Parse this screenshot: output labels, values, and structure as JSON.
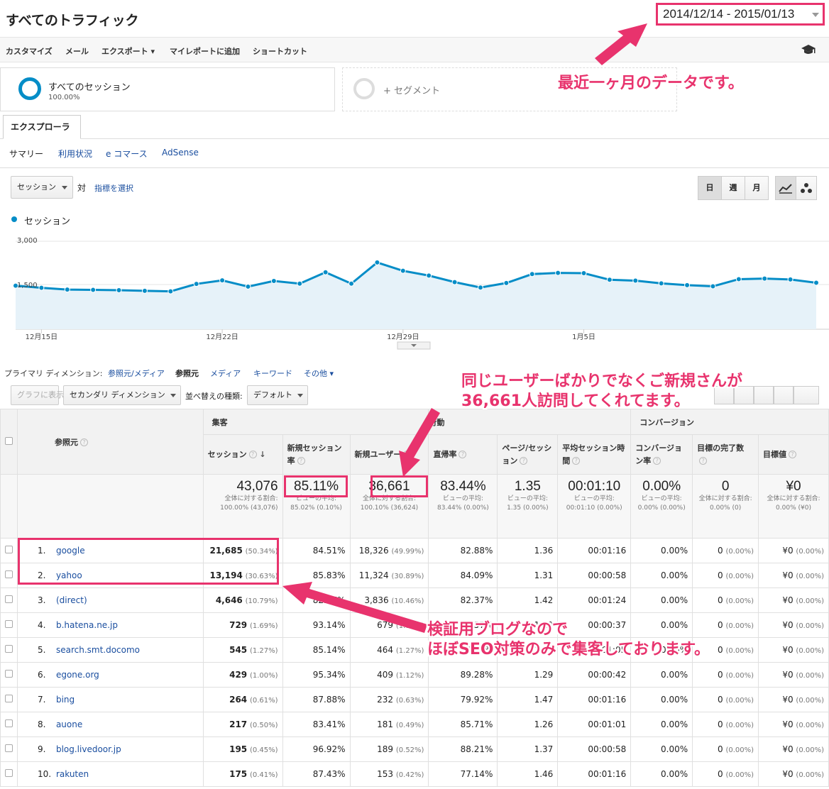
{
  "header": {
    "title": "すべてのトラフィック",
    "date_range": "2014/12/14 - 2015/01/13"
  },
  "toolbar": [
    "カスタマイズ",
    "メール",
    "エクスポート ▾",
    "マイレポートに追加",
    "ショートカット"
  ],
  "segments": {
    "active_name": "すべてのセッション",
    "active_pct": "100.00%",
    "add_label": "+ セグメント"
  },
  "tabs": {
    "explorer": "エクスプローラ",
    "subtabs": [
      "サマリー",
      "利用状況",
      "e コマース",
      "AdSense"
    ]
  },
  "chart_controls": {
    "metric": "セッション",
    "vs": "対",
    "pick_metric": "指標を選択",
    "periods": [
      "日",
      "週",
      "月"
    ]
  },
  "chart_data": {
    "type": "area",
    "legend": "セッション",
    "y_ticks": [
      "3,000",
      "1,500"
    ],
    "ylim": [
      0,
      3000
    ],
    "x_labels": [
      "12月15日",
      "12月22日",
      "12月29日",
      "1月5日"
    ],
    "x_label_index": [
      1,
      8,
      15,
      22
    ],
    "values": [
      1460,
      1390,
      1330,
      1320,
      1310,
      1290,
      1270,
      1520,
      1640,
      1430,
      1620,
      1530,
      1910,
      1530,
      2240,
      1960,
      1800,
      1580,
      1400,
      1550,
      1850,
      1890,
      1880,
      1660,
      1630,
      1540,
      1480,
      1440,
      1680,
      1700,
      1670,
      1560
    ],
    "color": "#058dc7"
  },
  "dimensions": {
    "label": "プライマリ ディメンション:",
    "items": [
      "参照元/メディア",
      "参照元",
      "メディア",
      "キーワード",
      "その他 ▾"
    ],
    "active": "参照元"
  },
  "controls": {
    "graph_btn": "グラフに表示",
    "secondary": "セカンダリ ディメンション",
    "sort_label": "並べ替えの種類:",
    "sort_value": "デフォルト"
  },
  "table": {
    "groups": [
      "集客",
      "行動",
      "コンバージョン"
    ],
    "dim_header": "参照元",
    "columns": [
      "セッション",
      "新規セッション率",
      "新規ユーザー",
      "直帰率",
      "ページ/セッション",
      "平均セッション時間",
      "コンバージョン率",
      "目標の完了数",
      "目標値"
    ],
    "totals": [
      {
        "value": "43,076",
        "sub": "全体に対する割合: 100.00% (43,076)"
      },
      {
        "value": "85.11%",
        "sub": "ビューの平均: 85.02% (0.10%)"
      },
      {
        "value": "36,661",
        "sub": "全体に対する割合: 100.10% (36,624)"
      },
      {
        "value": "83.44%",
        "sub": "ビューの平均: 83.44% (0.00%)"
      },
      {
        "value": "1.35",
        "sub": "ビューの平均: 1.35 (0.00%)"
      },
      {
        "value": "00:01:10",
        "sub": "ビューの平均: 00:01:10 (0.00%)"
      },
      {
        "value": "0.00%",
        "sub": "ビューの平均: 0.00% (0.00%)"
      },
      {
        "value": "0",
        "sub": "全体に対する割合: 0.00% (0)"
      },
      {
        "value": "¥0",
        "sub": "全体に対する割合: 0.00% (¥0)"
      }
    ],
    "rows": [
      {
        "idx": "1.",
        "name": "google",
        "sessions": "21,685",
        "sessions_pct": "(50.34%)",
        "new_rate": "84.51%",
        "new_users": "18,326",
        "new_users_pct": "(49.99%)",
        "bounce": "82.88%",
        "pps": "1.36",
        "dur": "00:01:16",
        "conv": "0.00%",
        "goals": "0",
        "goals_pct": "(0.00%)",
        "value": "¥0",
        "value_pct": "(0.00%)"
      },
      {
        "idx": "2.",
        "name": "yahoo",
        "sessions": "13,194",
        "sessions_pct": "(30.63%)",
        "new_rate": "85.83%",
        "new_users": "11,324",
        "new_users_pct": "(30.89%)",
        "bounce": "84.09%",
        "pps": "1.31",
        "dur": "00:00:58",
        "conv": "0.00%",
        "goals": "0",
        "goals_pct": "(0.00%)",
        "value": "¥0",
        "value_pct": "(0.00%)"
      },
      {
        "idx": "3.",
        "name": "(direct)",
        "sessions": "4,646",
        "sessions_pct": "(10.79%)",
        "new_rate": "82.57%",
        "new_users": "3,836",
        "new_users_pct": "(10.46%)",
        "bounce": "82.37%",
        "pps": "1.42",
        "dur": "00:01:24",
        "conv": "0.00%",
        "goals": "0",
        "goals_pct": "(0.00%)",
        "value": "¥0",
        "value_pct": "(0.00%)"
      },
      {
        "idx": "4.",
        "name": "b.hatena.ne.jp",
        "sessions": "729",
        "sessions_pct": "(1.69%)",
        "new_rate": "93.14%",
        "new_users": "679",
        "new_users_pct": "(1.85%)",
        "bounce": "89.57%",
        "pps": "1.29",
        "dur": "00:00:37",
        "conv": "0.00%",
        "goals": "0",
        "goals_pct": "(0.00%)",
        "value": "¥0",
        "value_pct": "(0.00%)"
      },
      {
        "idx": "5.",
        "name": "search.smt.docomo",
        "sessions": "545",
        "sessions_pct": "(1.27%)",
        "new_rate": "85.14%",
        "new_users": "464",
        "new_users_pct": "(1.27%)",
        "bounce": "83.49%",
        "pps": "1.26",
        "dur": "00:01:05",
        "conv": "0.00%",
        "goals": "0",
        "goals_pct": "(0.00%)",
        "value": "¥0",
        "value_pct": "(0.00%)"
      },
      {
        "idx": "6.",
        "name": "egone.org",
        "sessions": "429",
        "sessions_pct": "(1.00%)",
        "new_rate": "95.34%",
        "new_users": "409",
        "new_users_pct": "(1.12%)",
        "bounce": "89.28%",
        "pps": "1.29",
        "dur": "00:00:42",
        "conv": "0.00%",
        "goals": "0",
        "goals_pct": "(0.00%)",
        "value": "¥0",
        "value_pct": "(0.00%)"
      },
      {
        "idx": "7.",
        "name": "bing",
        "sessions": "264",
        "sessions_pct": "(0.61%)",
        "new_rate": "87.88%",
        "new_users": "232",
        "new_users_pct": "(0.63%)",
        "bounce": "79.92%",
        "pps": "1.47",
        "dur": "00:01:16",
        "conv": "0.00%",
        "goals": "0",
        "goals_pct": "(0.00%)",
        "value": "¥0",
        "value_pct": "(0.00%)"
      },
      {
        "idx": "8.",
        "name": "auone",
        "sessions": "217",
        "sessions_pct": "(0.50%)",
        "new_rate": "83.41%",
        "new_users": "181",
        "new_users_pct": "(0.49%)",
        "bounce": "85.71%",
        "pps": "1.26",
        "dur": "00:01:01",
        "conv": "0.00%",
        "goals": "0",
        "goals_pct": "(0.00%)",
        "value": "¥0",
        "value_pct": "(0.00%)"
      },
      {
        "idx": "9.",
        "name": "blog.livedoor.jp",
        "sessions": "195",
        "sessions_pct": "(0.45%)",
        "new_rate": "96.92%",
        "new_users": "189",
        "new_users_pct": "(0.52%)",
        "bounce": "88.21%",
        "pps": "1.37",
        "dur": "00:00:58",
        "conv": "0.00%",
        "goals": "0",
        "goals_pct": "(0.00%)",
        "value": "¥0",
        "value_pct": "(0.00%)"
      },
      {
        "idx": "10.",
        "name": "rakuten",
        "sessions": "175",
        "sessions_pct": "(0.41%)",
        "new_rate": "87.43%",
        "new_users": "153",
        "new_users_pct": "(0.42%)",
        "bounce": "77.14%",
        "pps": "1.46",
        "dur": "00:01:16",
        "conv": "0.00%",
        "goals": "0",
        "goals_pct": "(0.00%)",
        "value": "¥0",
        "value_pct": "(0.00%)"
      }
    ]
  },
  "annotations": {
    "date_note": "最近一ヶ月のデータです。",
    "new_users_note_1": "同じユーザーばかりでなくご新規さんが",
    "new_users_note_2": "36,661人訪問してくれてます。",
    "seo_note_1": "検証用ブログなので",
    "seo_note_2": "ほぼSEO対策のみで集客しております。",
    "accent": "#e8336d"
  }
}
